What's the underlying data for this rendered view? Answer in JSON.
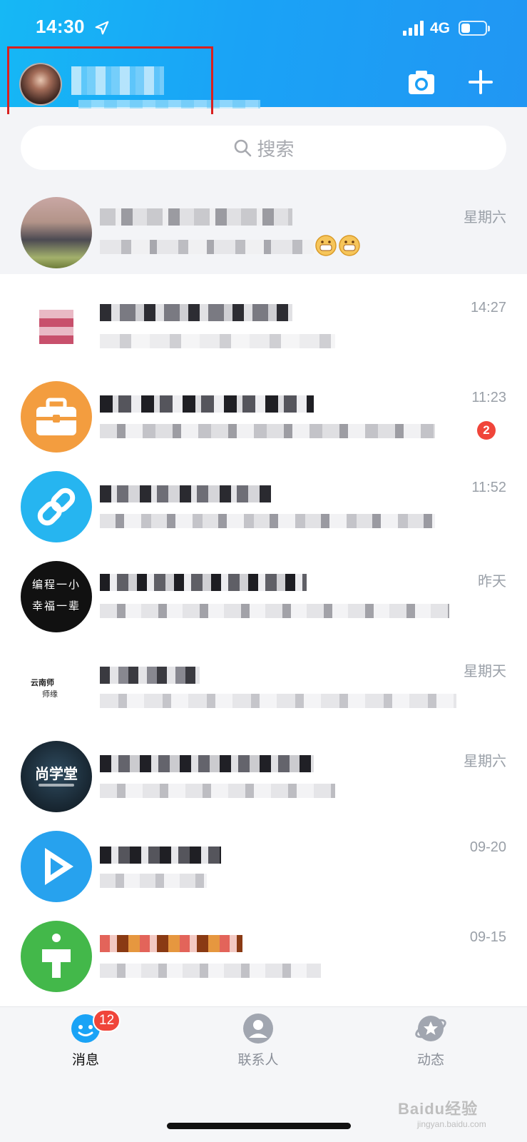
{
  "status_bar": {
    "time": "14:30",
    "network": "4G"
  },
  "header": {
    "camera_icon": "camera-icon",
    "add_icon": "plus-icon"
  },
  "search": {
    "placeholder": "搜索"
  },
  "chats": [
    {
      "time": "星期六",
      "unread": ""
    },
    {
      "time": "14:27",
      "unread": ""
    },
    {
      "time": "11:23",
      "unread": "2"
    },
    {
      "time": "11:52",
      "unread": ""
    },
    {
      "time": "昨天",
      "unread": ""
    },
    {
      "time": "星期天",
      "unread": ""
    },
    {
      "time": "星期六",
      "unread": ""
    },
    {
      "time": "09-20",
      "unread": ""
    },
    {
      "time": "09-15",
      "unread": ""
    }
  ],
  "avatars": {
    "lyric_top": "编程一小",
    "lyric_bottom": "幸福一辈",
    "school_top": "云南师",
    "school_bottom": "师缘",
    "shangxuetang": "尚学堂"
  },
  "tabbar": {
    "messages": {
      "label": "消息",
      "badge": "12"
    },
    "contacts": {
      "label": "联系人"
    },
    "dynamic": {
      "label": "动态"
    }
  },
  "watermark": {
    "brand": "Baidu经验",
    "url": "jingyan.baidu.com"
  },
  "colors": {
    "header": "#1aa3f6",
    "badge": "#f0453a",
    "active_tab": "#1aa3f6"
  }
}
